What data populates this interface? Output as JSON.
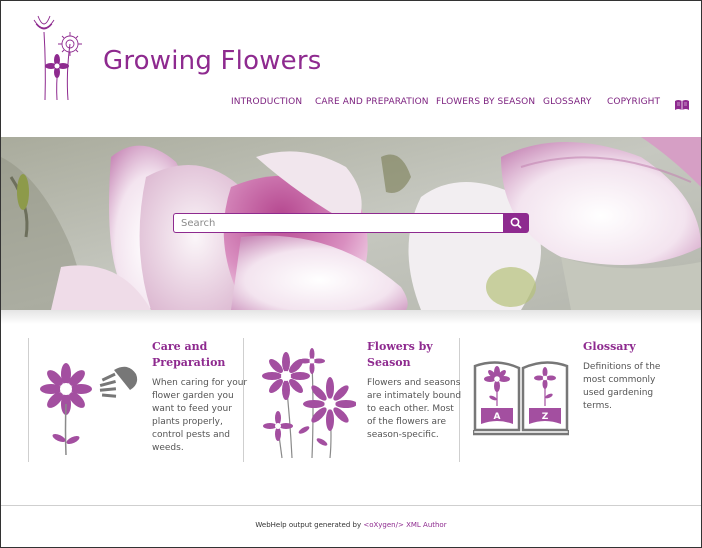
{
  "site": {
    "title": "Growing Flowers",
    "accent_color": "#8e2a8f",
    "logo_icon": "dandelion-flowers-logo"
  },
  "nav": {
    "items": [
      {
        "label": "INTRODUCTION"
      },
      {
        "label": "CARE AND PREPARATION"
      },
      {
        "label": "FLOWERS BY SEASON"
      },
      {
        "label": "GLOSSARY"
      },
      {
        "label": "COPYRIGHT"
      }
    ],
    "index_icon": "open-book-icon"
  },
  "search": {
    "placeholder": "Search",
    "button_icon": "search-icon"
  },
  "cards": [
    {
      "title_line1": "Care and",
      "title_line2": "Preparation",
      "text_lines": [
        "When caring for your",
        "flower garden you",
        "want to feed your",
        "plants properly,",
        "control pests and",
        "weeds."
      ],
      "icon": "flower-watering-can-icon"
    },
    {
      "title_line1": "Flowers by",
      "title_line2": "Season",
      "text_lines": [
        "Flowers and seasons",
        "are intimately bound",
        "to each other. Most",
        "of the flowers are",
        "season-specific."
      ],
      "icon": "flower-bouquet-icon"
    },
    {
      "title_line1": "Glossary",
      "text_lines": [
        "Definitions of the",
        "most commonly",
        "used gardening",
        "terms."
      ],
      "icon": "a-z-book-icon",
      "book_letters": [
        "A",
        "Z"
      ]
    }
  ],
  "footer": {
    "prefix": "WebHelp output generated by ",
    "link": "<oXygen/> XML Author"
  }
}
